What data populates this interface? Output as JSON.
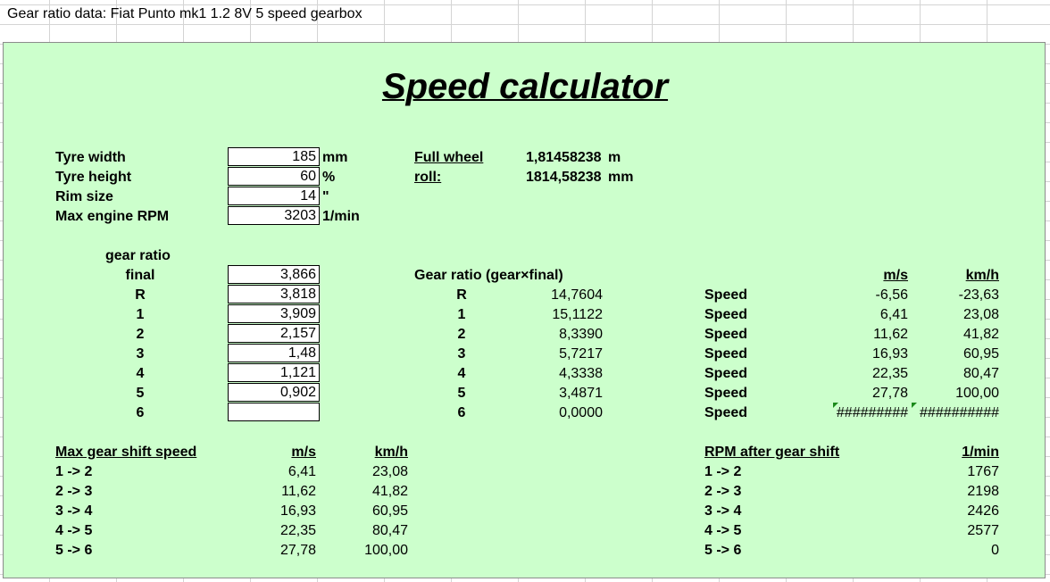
{
  "sheet": {
    "title": "Gear ratio data: Fiat Punto mk1 1.2 8V 5 speed gearbox"
  },
  "calculator": {
    "title": "Speed calculator",
    "inputs": [
      {
        "label": "Tyre width",
        "value": "185",
        "unit": "mm"
      },
      {
        "label": "Tyre height",
        "value": "60",
        "unit": "%"
      },
      {
        "label": "Rim size",
        "value": "14",
        "unit": "\""
      },
      {
        "label": "Max engine RPM",
        "value": "3203",
        "unit": "1/min"
      }
    ],
    "full_wheel": {
      "label1": "Full wheel",
      "label2": "roll:",
      "value_m": "1,81458238",
      "unit_m": "m",
      "value_mm": "1814,58238",
      "unit_mm": "mm"
    },
    "gear_ratio_header": "gear ratio",
    "gears": [
      {
        "label": "final",
        "value": "3,866"
      },
      {
        "label": "R",
        "value": "3,818"
      },
      {
        "label": "1",
        "value": "3,909"
      },
      {
        "label": "2",
        "value": "2,157"
      },
      {
        "label": "3",
        "value": "1,48"
      },
      {
        "label": "4",
        "value": "1,121"
      },
      {
        "label": "5",
        "value": "0,902"
      },
      {
        "label": "6",
        "value": ""
      }
    ],
    "combined_header": "Gear ratio (gear×final)",
    "combined": [
      {
        "label": "R",
        "value": "14,7604"
      },
      {
        "label": "1",
        "value": "15,1122"
      },
      {
        "label": "2",
        "value": "8,3390"
      },
      {
        "label": "3",
        "value": "5,7217"
      },
      {
        "label": "4",
        "value": "4,3338"
      },
      {
        "label": "5",
        "value": "3,4871"
      },
      {
        "label": "6",
        "value": "0,0000"
      }
    ],
    "speed_headers": {
      "ms": "m/s",
      "kmh": "km/h"
    },
    "speeds": [
      {
        "label": "Speed",
        "ms": "-6,56",
        "kmh": "-23,63"
      },
      {
        "label": "Speed",
        "ms": "6,41",
        "kmh": "23,08"
      },
      {
        "label": "Speed",
        "ms": "11,62",
        "kmh": "41,82"
      },
      {
        "label": "Speed",
        "ms": "16,93",
        "kmh": "60,95"
      },
      {
        "label": "Speed",
        "ms": "22,35",
        "kmh": "80,47"
      },
      {
        "label": "Speed",
        "ms": "27,78",
        "kmh": "100,00"
      },
      {
        "label": "Speed",
        "ms": "#########",
        "kmh": "##########"
      }
    ],
    "shift_speed": {
      "header": "Max gear shift speed",
      "ms": "m/s",
      "kmh": "km/h",
      "rows": [
        {
          "label": "1 -> 2",
          "ms": "6,41",
          "kmh": "23,08"
        },
        {
          "label": "2 -> 3",
          "ms": "11,62",
          "kmh": "41,82"
        },
        {
          "label": "3 -> 4",
          "ms": "16,93",
          "kmh": "60,95"
        },
        {
          "label": "4 -> 5",
          "ms": "22,35",
          "kmh": "80,47"
        },
        {
          "label": "5 -> 6",
          "ms": "27,78",
          "kmh": "100,00"
        }
      ]
    },
    "rpm_shift": {
      "header": "RPM after gear shift",
      "unit": "1/min",
      "rows": [
        {
          "label": "1 -> 2",
          "value": "1767"
        },
        {
          "label": "2 -> 3",
          "value": "2198"
        },
        {
          "label": "3 -> 4",
          "value": "2426"
        },
        {
          "label": "4 -> 5",
          "value": "2577"
        },
        {
          "label": "5 -> 6",
          "value": "0"
        }
      ]
    }
  },
  "colors": {
    "panel": "#ccffcc",
    "grid": "#d4d4d4",
    "error_indicator": "#1a8a1a"
  }
}
